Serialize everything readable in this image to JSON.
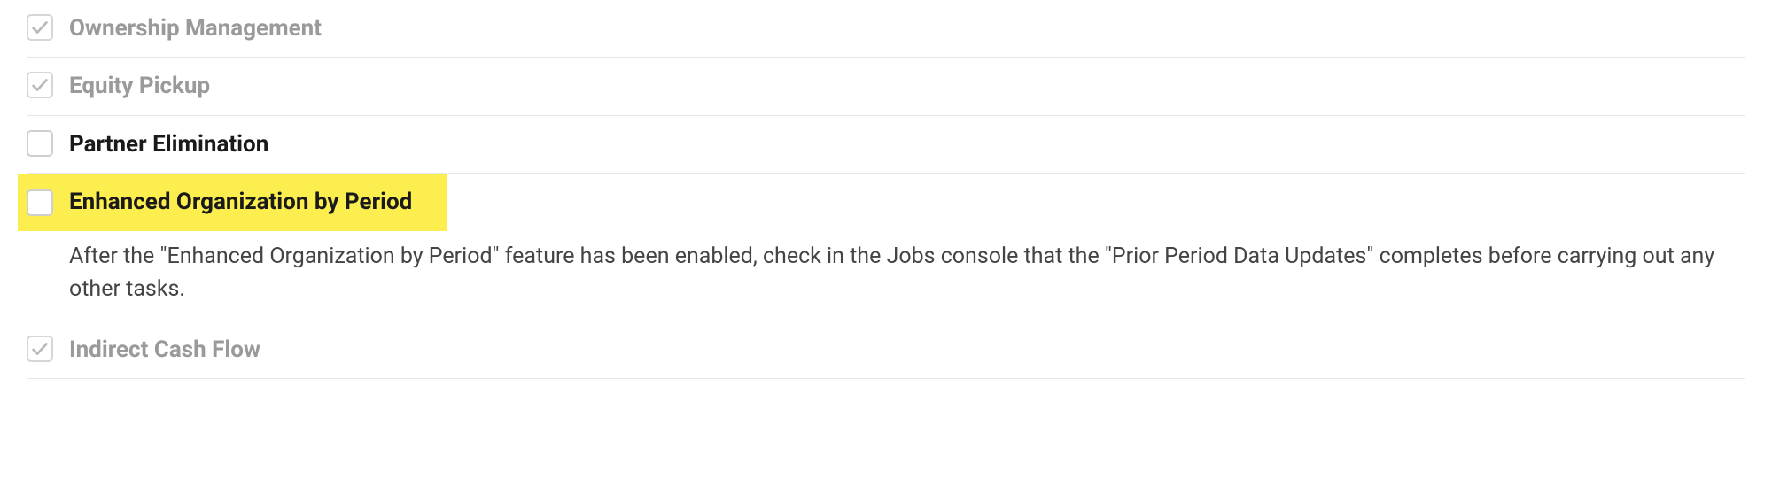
{
  "items": [
    {
      "key": "ownership-management",
      "label": "Ownership Management",
      "checked": true,
      "disabled": true,
      "highlighted": false,
      "description": ""
    },
    {
      "key": "equity-pickup",
      "label": "Equity Pickup",
      "checked": true,
      "disabled": true,
      "highlighted": false,
      "description": ""
    },
    {
      "key": "partner-elimination",
      "label": "Partner Elimination",
      "checked": false,
      "disabled": false,
      "highlighted": false,
      "description": ""
    },
    {
      "key": "enhanced-org-by-period",
      "label": "Enhanced Organization by Period",
      "checked": false,
      "disabled": false,
      "highlighted": true,
      "description": "After the \"Enhanced Organization by Period\" feature has been enabled, check in the Jobs console that the \"Prior Period Data Updates\" completes before carrying out any other tasks."
    },
    {
      "key": "indirect-cash-flow",
      "label": "Indirect Cash Flow",
      "checked": true,
      "disabled": true,
      "highlighted": false,
      "description": ""
    }
  ],
  "colors": {
    "highlight": "#fcee4f",
    "disabledText": "#9a9a9a",
    "activeText": "#1a1a1a",
    "checkStroke": "#b9b9b9"
  }
}
